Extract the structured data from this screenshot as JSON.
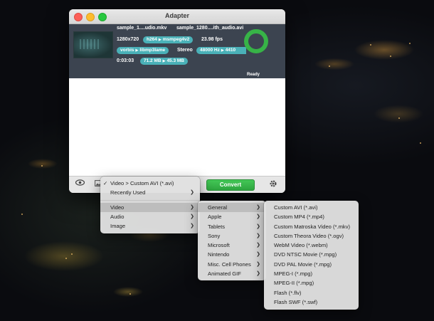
{
  "window": {
    "title": "Adapter"
  },
  "file": {
    "input_name": "sample_1....udio.mkv",
    "output_name": "sample_1280....ith_audio.avi",
    "resolution": "1280x720",
    "video_codec_from": "h264",
    "video_codec_to": "msmpeg4v2",
    "fps": "23.98 fps",
    "audio_codec_from": "vorbis",
    "audio_codec_to": "libmp3lame",
    "channels": "Stereo",
    "sample_rate_from": "48000 Hz",
    "sample_rate_to": "4410",
    "duration": "0:03:03",
    "size_from": "71.2 MB",
    "size_to": "45.3 MB",
    "status": "Ready"
  },
  "toolbar": {
    "convert_label": "Convert",
    "preview_icon": "eye-icon",
    "image_icon": "image-icon",
    "settings_icon": "gear-icon"
  },
  "menu_main": {
    "selected_label": "Video > Custom AVI (*.avi)",
    "recently_used": "Recently Used",
    "categories": [
      "Video",
      "Audio",
      "Image"
    ]
  },
  "menu_video": [
    "General",
    "Apple",
    "Tablets",
    "Sony",
    "Microsoft",
    "Nintendo",
    "Misc. Cell Phones",
    "Animated GIF"
  ],
  "menu_general": [
    "Custom AVI (*.avi)",
    "Custom MP4 (*.mp4)",
    "Custom Matroska Video (*.mkv)",
    "Custom Theora Video (*.ogv)",
    "WebM Video (*.webm)",
    "DVD NTSC Movie (*.mpg)",
    "DVD PAL Movie (*.mpg)",
    "MPEG-I (*.mpg)",
    "MPEG-II (*.mpg)",
    "Flash (*.flv)",
    "Flash SWF (*.swf)"
  ],
  "colors": {
    "accent_teal": "#4ab1b8",
    "convert_green": "#37b347",
    "row_bg": "#3c4450"
  }
}
